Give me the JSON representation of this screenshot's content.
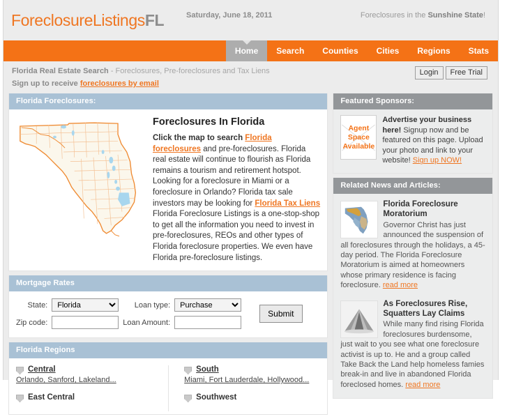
{
  "header": {
    "logo_main": "ForeclosureListings",
    "logo_suffix": "FL",
    "date": "Saturday, June 18, 2011",
    "tagline_pre": "Foreclosures in the ",
    "tagline_bold": "Sunshine State",
    "tagline_post": "!",
    "accent_color": "#f47216",
    "logo_color": "#ef7622"
  },
  "nav": {
    "items": [
      {
        "label": "Home",
        "active": true
      },
      {
        "label": "Search",
        "active": false
      },
      {
        "label": "Counties",
        "active": false
      },
      {
        "label": "Cities",
        "active": false
      },
      {
        "label": "Regions",
        "active": false
      },
      {
        "label": "Stats",
        "active": false
      }
    ]
  },
  "subheader": {
    "title_bold": "Florida Real Estate Search",
    "title_rest": " - Foreclosures, Pre-foreclosures and Tax Liens",
    "signup_pre": "Sign up to receive ",
    "signup_link": "foreclosures by email",
    "login_label": "Login",
    "free_trial_label": "Free Trial"
  },
  "foreclosures_panel": {
    "header": "Florida Foreclosures:",
    "heading": "Foreclosures In Florida",
    "lead": "Click the map to search ",
    "link1": "Florida foreclosures",
    "body1": " and pre-foreclosures. Florida real estate will continue to flourish as Florida remains a tourism and retirement hotspot. Looking for a foreclosure in Miami or a foreclosure in Orlando? Florida tax sale investors may be looking for ",
    "link2": "Florida Tax Liens",
    "body2": " Florida Foreclosure Listings is a one-stop-shop to get all the information you need to invest in pre-foreclosures, REOs and other types of Florida foreclosure properties. We even have Florida pre-foreclosure listings.",
    "map_alt": "florida-county-map"
  },
  "mortgage": {
    "header": "Mortgage Rates",
    "state_label": "State:",
    "state_value": "Florida",
    "state_options": [
      "Florida"
    ],
    "loan_type_label": "Loan type:",
    "loan_type_value": "Purchase",
    "loan_type_options": [
      "Purchase"
    ],
    "zip_label": "Zip code:",
    "zip_value": "",
    "zip_placeholder": "",
    "amount_label": "Loan Amount:",
    "amount_value": "",
    "amount_placeholder": "",
    "submit_label": "Submit"
  },
  "regions": {
    "header": "Florida Regions",
    "columns": [
      [
        {
          "name": "Central",
          "cities": "Orlando, Sanford, Lakeland..."
        },
        {
          "name": "East Central",
          "cities": ""
        }
      ],
      [
        {
          "name": "South",
          "cities": "Miami, Fort Lauderdale, Hollywood..."
        },
        {
          "name": "Southwest",
          "cities": ""
        }
      ]
    ]
  },
  "sponsors": {
    "header": "Featured Sponsors:",
    "badge_line1": "Agent",
    "badge_line2": "Space",
    "badge_line3": "Available",
    "title": "Advertise your business here!",
    "body": "Signup now and be featured on this page. Upload your photo and link to your website! ",
    "link": "Sign up NOW!"
  },
  "news": {
    "header": "Related News and Articles:",
    "items": [
      {
        "thumb": "florida-map-thumbnail",
        "title": "Florida Foreclosure Moratorium",
        "body": "Governor Christ has just announced the suspension of all foreclosures through the holidays, a 45-day period. The Florida Foreclosure Moratorium is aimed at homeowners whose primary residence is facing foreclosure. ",
        "link": "read more"
      },
      {
        "thumb": "tent-photo-thumbnail",
        "title": "As Foreclosures Rise, Squatters Lay Claims",
        "body": "While many find rising Florida foreclosures burdensome, just wait to you see what one foreclosure activist is up to. He and a group called Take Back the Land help homeless famies break-in and live in abandoned Florida foreclosed homes. ",
        "link": "read more"
      }
    ]
  }
}
